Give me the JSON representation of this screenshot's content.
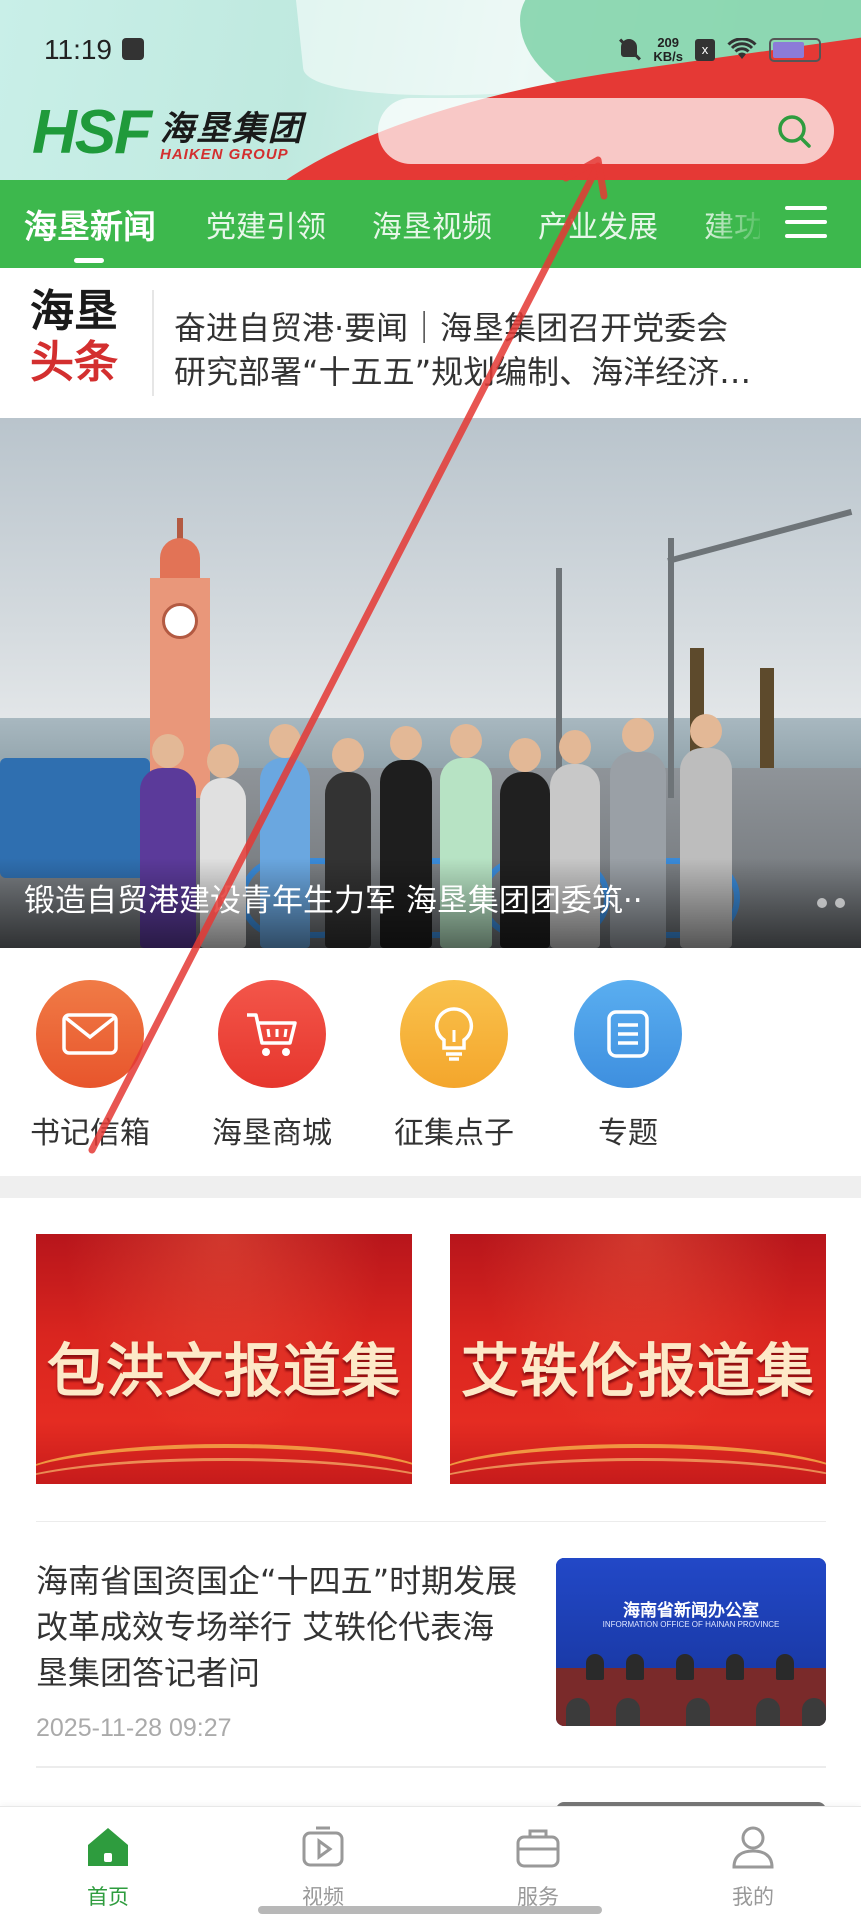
{
  "status_bar": {
    "time": "11:19",
    "net_speed_value": "209",
    "net_speed_unit": "KB/s",
    "sim_badge": "x",
    "battery_level": 0.7
  },
  "header": {
    "logo_mark": "HSF",
    "logo_cn": "海垦集团",
    "logo_en": "HAIKEN GROUP",
    "search_placeholder": "",
    "search_icon": "search-icon"
  },
  "tabs": [
    {
      "label": "海垦新闻",
      "active": true
    },
    {
      "label": "党建引领",
      "active": false
    },
    {
      "label": "海垦视频",
      "active": false
    },
    {
      "label": "产业发展",
      "active": false
    },
    {
      "label": "建功",
      "active": false
    }
  ],
  "headline": {
    "badge_line1": "海垦",
    "badge_line2": "头条",
    "line1": "奋进自贸港·要闻｜海垦集团召开党委会",
    "line2": "研究部署“十五五”规划编制、海洋经济…"
  },
  "banner": {
    "caption": "锻造自贸港建设青年生力军 海垦集团团委筑··"
  },
  "quick_actions": [
    {
      "label": "书记信箱",
      "icon": "mail-icon",
      "color": "#ef6a3a"
    },
    {
      "label": "海垦商城",
      "icon": "cart-icon",
      "color": "#f0433a"
    },
    {
      "label": "征集点子",
      "icon": "lightbulb-icon",
      "color": "#f6b53a"
    },
    {
      "label": "专题",
      "icon": "document-icon",
      "color": "#4a9fe6"
    }
  ],
  "reports": [
    {
      "title": "包洪文报道集"
    },
    {
      "title": "艾轶伦报道集"
    }
  ],
  "news": [
    {
      "title": "海南省国资国企“十四五”时期发展改革成效专场举行 艾轶伦代表海垦集团答记者问",
      "time": "2025-11-28 09:27",
      "thumb_caption_cn": "海南省新闻办公室",
      "thumb_caption_en": "INFORMATION OFFICE OF HAINAN PROVINCE"
    }
  ],
  "bottom_nav": [
    {
      "label": "首页",
      "icon": "home-icon",
      "active": true
    },
    {
      "label": "视频",
      "icon": "video-icon",
      "active": false
    },
    {
      "label": "服务",
      "icon": "briefcase-icon",
      "active": false
    },
    {
      "label": "我的",
      "icon": "profile-icon",
      "active": false
    }
  ],
  "colors": {
    "brand_green": "#3db84d",
    "nav_active": "#2e9c3e",
    "accent_red": "#d32f2f",
    "annotation_red": "#e53935"
  }
}
